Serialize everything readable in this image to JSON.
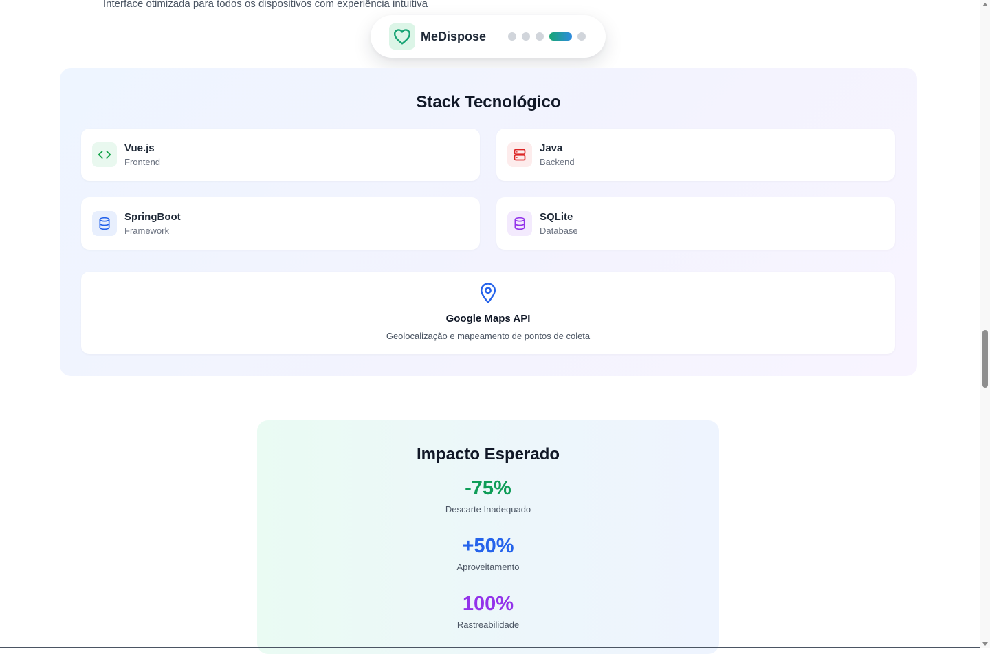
{
  "intro": {
    "text": "Interface otimizada para todos os dispositivos com experiência intuitiva"
  },
  "nav": {
    "brand": "MeDispose",
    "brand_icon": "heart-icon",
    "slides": 5,
    "active_slide": 4
  },
  "stack": {
    "title": "Stack Tecnológico",
    "items": [
      {
        "name": "Vue.js",
        "role": "Frontend",
        "icon": "code-icon",
        "color": "#16a34a",
        "bg": "#e9f8ef"
      },
      {
        "name": "Java",
        "role": "Backend",
        "icon": "server-icon",
        "color": "#dc2626",
        "bg": "#fdecec"
      },
      {
        "name": "SpringBoot",
        "role": "Framework",
        "icon": "database-icon",
        "color": "#2563eb",
        "bg": "#e8effd"
      },
      {
        "name": "SQLite",
        "role": "Database",
        "icon": "database-icon",
        "color": "#9333ea",
        "bg": "#f3eafd"
      }
    ],
    "maps": {
      "title": "Google Maps API",
      "description": "Geolocalização e mapeamento de pontos de coleta",
      "icon": "map-pin-icon",
      "color": "#2563eb"
    }
  },
  "impact": {
    "title": "Impacto Esperado",
    "metrics": [
      {
        "value": "-75%",
        "label": "Descarte Inadequado",
        "color": "#0f9d58"
      },
      {
        "value": "+50%",
        "label": "Aproveitamento",
        "color": "#2563eb"
      },
      {
        "value": "100%",
        "label": "Rastreabilidade",
        "color": "#9333ea"
      }
    ]
  }
}
